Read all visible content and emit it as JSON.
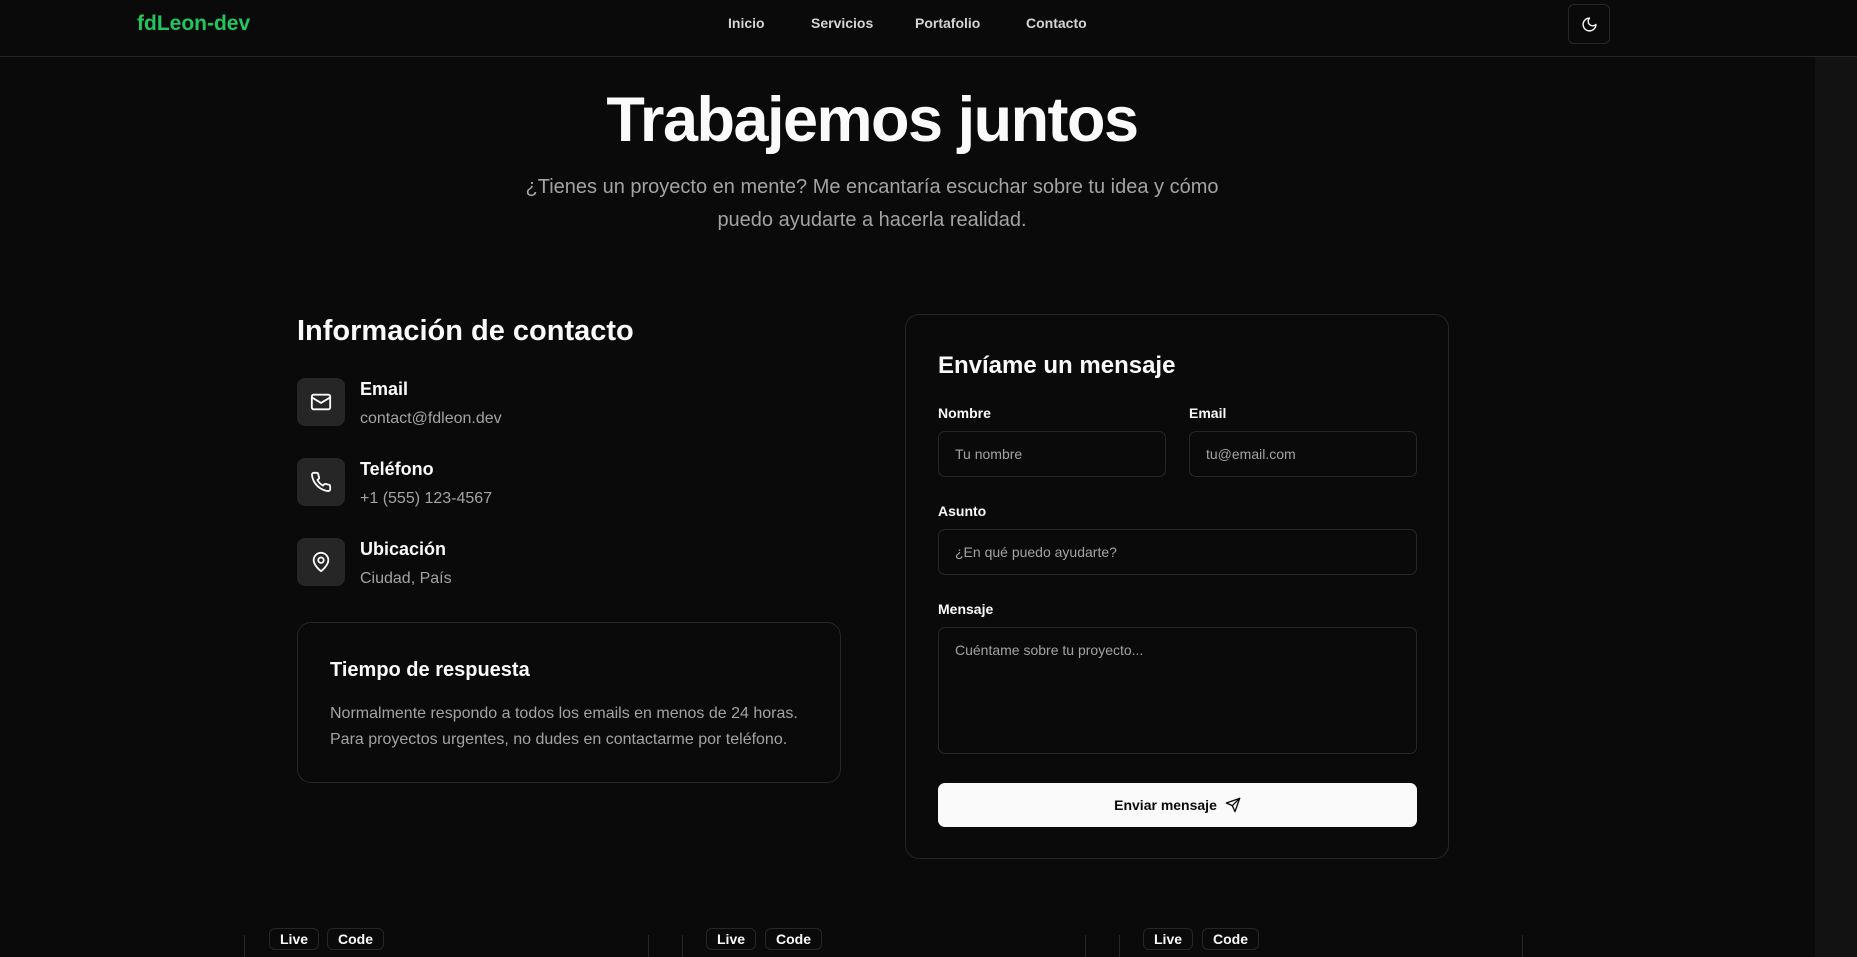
{
  "header": {
    "brand": "fdLeon-dev",
    "nav": [
      "Inicio",
      "Servicios",
      "Portafolio",
      "Contacto"
    ],
    "theme_icon": "moon-icon"
  },
  "hero": {
    "title": "Trabajemos juntos",
    "subtitle_line1": "¿Tienes un proyecto en mente? Me encantaría escuchar sobre tu idea y cómo",
    "subtitle_line2": "puedo ayudarte a hacerla realidad."
  },
  "contact_info": {
    "title": "Información de contacto",
    "items": [
      {
        "label": "Email",
        "value": "contact@fdleon.dev",
        "icon": "mail-icon"
      },
      {
        "label": "Teléfono",
        "value": "+1 (555) 123-4567",
        "icon": "phone-icon"
      },
      {
        "label": "Ubicación",
        "value": "Ciudad, País",
        "icon": "map-pin-icon"
      }
    ],
    "response": {
      "title": "Tiempo de respuesta",
      "line1": "Normalmente respondo a todos los emails en menos de 24 horas.",
      "line2": "Para proyectos urgentes, no dudes en contactarme por teléfono."
    }
  },
  "form": {
    "title": "Envíame un mensaje",
    "name_label": "Nombre",
    "name_placeholder": "Tu nombre",
    "email_label": "Email",
    "email_placeholder": "tu@email.com",
    "subject_label": "Asunto",
    "subject_placeholder": "¿En qué puedo ayudarte?",
    "message_label": "Mensaje",
    "message_placeholder": "Cuéntame sobre tu proyecto...",
    "submit_label": "Enviar mensaje",
    "submit_icon": "send-icon"
  },
  "projects_peek": {
    "live_label": "Live",
    "code_label": "Code"
  }
}
